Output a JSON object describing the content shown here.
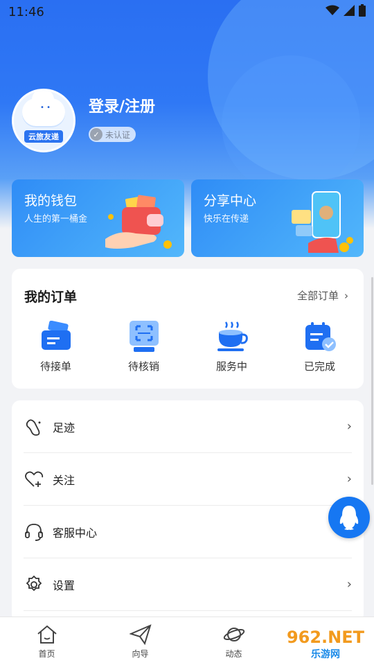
{
  "status_bar": {
    "time": "11:46"
  },
  "profile": {
    "login_title": "登录/注册",
    "verify_status": "未认证",
    "avatar_brand": "云旅友递"
  },
  "promos": [
    {
      "title": "我的钱包",
      "subtitle": "人生的第一桶金"
    },
    {
      "title": "分享中心",
      "subtitle": "快乐在传递"
    }
  ],
  "orders": {
    "title": "我的订单",
    "view_all": "全部订单",
    "items": [
      {
        "label": "待接单",
        "icon": "ticket-icon"
      },
      {
        "label": "待核销",
        "icon": "scan-code-icon"
      },
      {
        "label": "服务中",
        "icon": "coffee-cup-icon"
      },
      {
        "label": "已完成",
        "icon": "calendar-check-icon"
      }
    ]
  },
  "menu": {
    "items": [
      {
        "label": "足迹",
        "icon": "footprint-icon"
      },
      {
        "label": "关注",
        "icon": "heart-plus-icon"
      },
      {
        "label": "客服中心",
        "icon": "headset-icon"
      },
      {
        "label": "设置",
        "icon": "gear-icon"
      }
    ]
  },
  "tabbar": {
    "items": [
      {
        "label": "首页",
        "icon": "home-icon"
      },
      {
        "label": "向导",
        "icon": "paper-plane-icon"
      },
      {
        "label": "动态",
        "icon": "planet-icon"
      }
    ]
  },
  "watermark": {
    "top": "962.NET",
    "bottom": "乐游网"
  },
  "colors": {
    "brand": "#2f78f5",
    "card_bg": "#ffffff",
    "page_bg": "#f2f3f6"
  }
}
